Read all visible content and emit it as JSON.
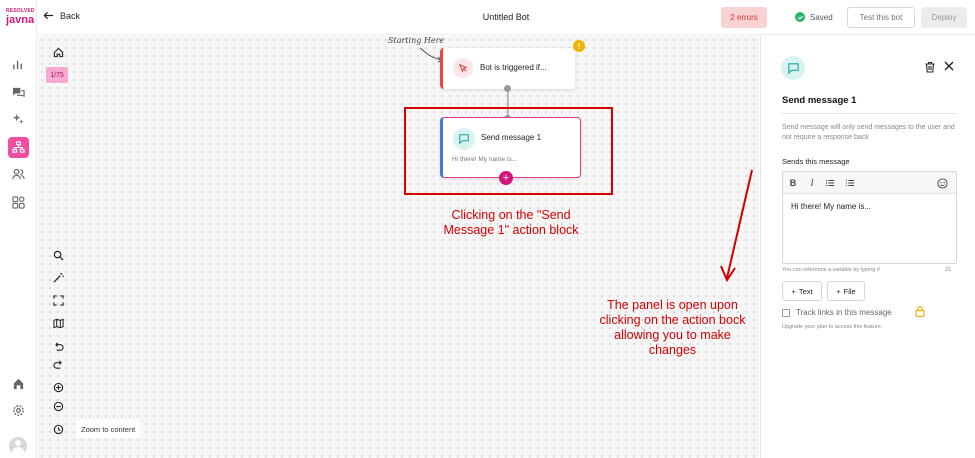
{
  "app": {
    "logo_top": "RESOLVED",
    "logo_main": "javna"
  },
  "rail": {
    "items": [
      "analytics-icon",
      "chat-icon",
      "sparkle-icon",
      "flow-icon",
      "users-icon",
      "apps-icon"
    ],
    "bottom": [
      "home-icon",
      "settings-icon",
      "avatar"
    ]
  },
  "topbar": {
    "back_label": "Back",
    "title": "Untitled Bot",
    "errors_label": "2 errors",
    "saved_label": "Saved",
    "test_label": "Test this bot",
    "deploy_label": "Deploy"
  },
  "canvas": {
    "counter": "1/75",
    "zoom_to_content_label": "Zoom to content",
    "starting_note": "Starting Here",
    "tools": [
      "search-icon",
      "magic-wand-icon",
      "fullscreen-icon",
      "map-icon",
      "undo-icon",
      "redo-icon",
      "zoom-in-icon",
      "zoom-out-icon",
      "history-icon"
    ],
    "trigger_node": {
      "label": "Bot is triggered if...",
      "warning": "!"
    },
    "send_node": {
      "label": "Send message 1",
      "preview": "Hi there! My name is..."
    },
    "annotation_click": "Clicking on the \"Send Message 1\" action block",
    "annotation_panel": "The panel is open upon clicking on the action bock allowing you to make changes"
  },
  "panel": {
    "title": "Send message 1",
    "description": "Send message will only send messages to the user and not require a response back",
    "sends_label": "Sends this message",
    "message_text": "Hi there! My name is...",
    "variable_hint": "You can reference a variable by typing #",
    "char_count": "21",
    "add_text_label": "Text",
    "add_file_label": "File",
    "track_links_label": "Track links in this message",
    "upgrade_note": "Upgrade your plan to access this feature.",
    "colors": {
      "accent": "#d4157b",
      "error": "#d40000",
      "teal": "#1aa59c"
    }
  }
}
